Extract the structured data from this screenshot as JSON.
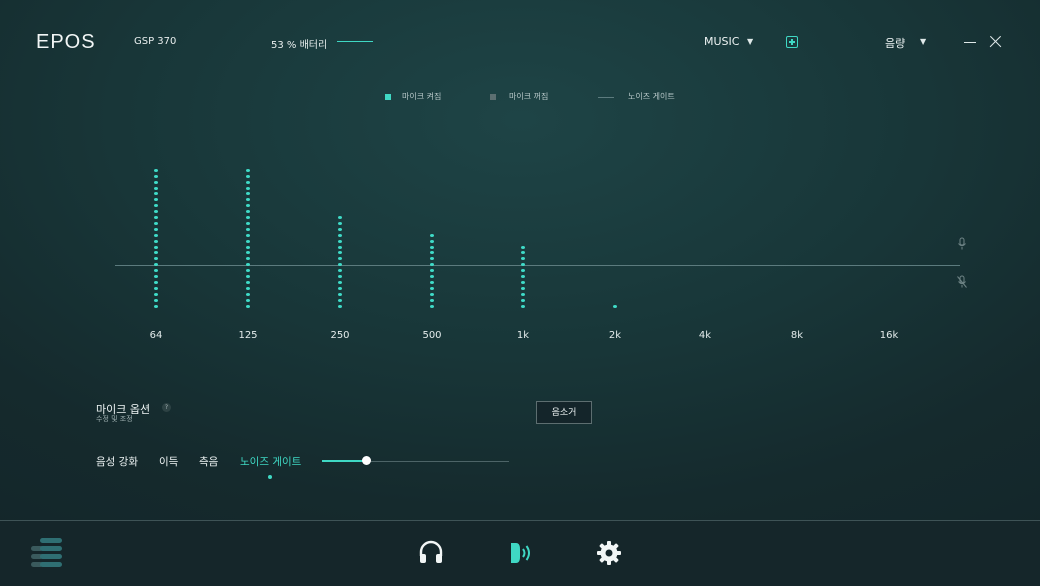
{
  "header": {
    "logo": "EPOS",
    "model": "GSP 370",
    "battery": "53 % 배터리",
    "preset": "MUSIC",
    "volume": "음량"
  },
  "legend": {
    "mic_on": "마이크 켜짐",
    "mic_off": "마이크 꺼짐",
    "noise_gate": "노이즈 게이트"
  },
  "chart_data": {
    "type": "bar",
    "categories": [
      "64",
      "125",
      "250",
      "500",
      "1k",
      "2k",
      "4k",
      "8k",
      "16k"
    ],
    "values": [
      24,
      24,
      16,
      13,
      11,
      1,
      0,
      0,
      0
    ],
    "threshold_level": 7,
    "ylim": [
      0,
      24
    ],
    "colors": {
      "dots": "#3fdcc8",
      "threshold": "#5c7b7e"
    }
  },
  "mic_options": {
    "title": "마이크 옵션",
    "subtitle": "수정 및 조정",
    "help": "?",
    "sidetone_button": "음소거"
  },
  "tabs": [
    "음성 강화",
    "이득",
    "측음",
    "노이즈 게이트"
  ],
  "active_tab": "노이즈 게이트",
  "noise_gate_slider": {
    "value": 0.24
  },
  "colors": {
    "accent": "#3fd8c4"
  }
}
